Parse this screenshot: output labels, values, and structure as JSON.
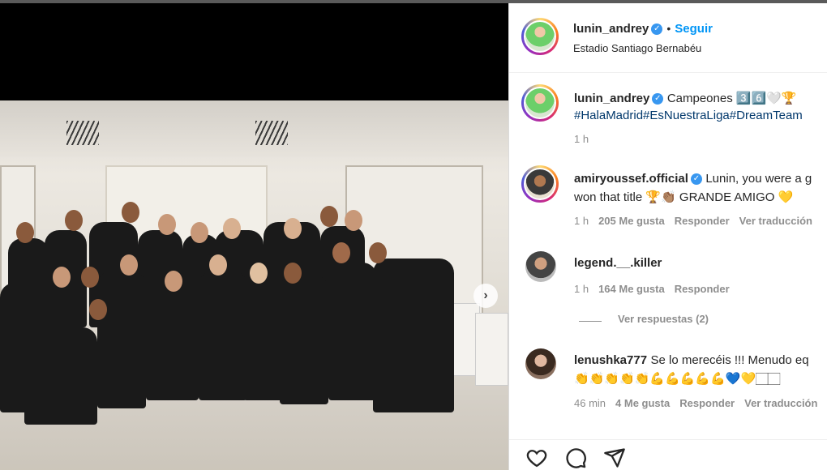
{
  "post": {
    "author": "lunin_andrey",
    "follow_label": "Seguir",
    "location": "Estadio Santiago Bernabéu",
    "caption": {
      "author": "lunin_andrey",
      "text": "Campeones 3️⃣6️⃣🤍🏆",
      "hashtags": "#HalaMadrid#EsNuestraLiga#DreamTeam",
      "time": "1 h"
    }
  },
  "comments": [
    {
      "author": "amiryoussef.official",
      "verified": true,
      "line1": "Lunin, you were a g",
      "line2": "won that title 🏆👏🏽 GRANDE AMIGO 💛",
      "time": "1 h",
      "likes": "205 Me gusta",
      "reply": "Responder",
      "translate": "Ver traducción"
    },
    {
      "author": "legend.__.killer",
      "text": "",
      "time": "1 h",
      "likes": "164 Me gusta",
      "reply": "Responder",
      "view_replies": "Ver respuestas (2)"
    },
    {
      "author": "lenushka777",
      "line1": "Se lo merecéis !!! Menudo eq",
      "line2": "👏👏👏👏👏💪💪💪💪💪💙💛🏻🏻",
      "time": "46 min",
      "likes": "4 Me gusta",
      "reply": "Responder",
      "translate": "Ver traducción"
    }
  ],
  "icons": {
    "verified": "verified-badge-icon",
    "next": "chevron-right-icon",
    "like": "heart-icon",
    "comment": "comment-icon",
    "share": "paper-plane-icon"
  },
  "colors": {
    "link": "#0095f6",
    "hashtag": "#00376b",
    "verified": "#3897f0",
    "muted": "#8e8e8e"
  }
}
